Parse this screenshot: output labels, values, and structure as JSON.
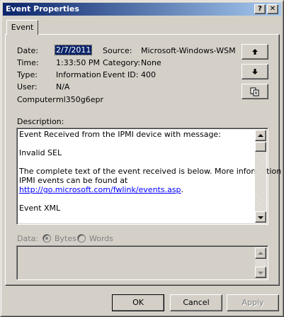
{
  "window": {
    "title": "Event Properties",
    "help_label": "?",
    "close_label": "✕"
  },
  "tabs": [
    {
      "label": "Event"
    }
  ],
  "event": {
    "date_label": "Date:",
    "date_value": "2/7/2011",
    "time_label": "Time:",
    "time_value": "1:33:50 PM",
    "type_label": "Type:",
    "type_value": "Information",
    "user_label": "User:",
    "user_value": "N/A",
    "computer_label": "Computer:",
    "computer_value": "ml350g6epr",
    "source_label": "Source:",
    "source_value": "Microsoft-Windows-WSM",
    "category_label": "Category:",
    "category_value": "None",
    "eventid_label": "Event ID:",
    "eventid_value": "400"
  },
  "side_buttons": [
    {
      "icon": "arrow-up-icon"
    },
    {
      "icon": "arrow-down-icon"
    },
    {
      "icon": "copy-icon"
    }
  ],
  "description": {
    "label": "Description:",
    "line1": "Event Received from the IPMI device with message:",
    "line2": "Invalid SEL",
    "line3a": "The complete text of the event received is below. More information on",
    "line3b": "IPMI events can be found at",
    "link": "http://go.microsoft.com/fwlink/events.asp",
    "link_suffix": ".",
    "line4": "Event XML"
  },
  "data_section": {
    "label": "Data:",
    "options": [
      {
        "label": "Bytes",
        "selected": true
      },
      {
        "label": "Words",
        "selected": false
      }
    ]
  },
  "footer": {
    "ok_label": "OK",
    "cancel_label": "Cancel",
    "apply_label": "Apply"
  },
  "colors": {
    "face": "#d4d0c8",
    "title_start": "#0a246a",
    "title_end": "#a6caf0",
    "link": "#0000ff"
  }
}
